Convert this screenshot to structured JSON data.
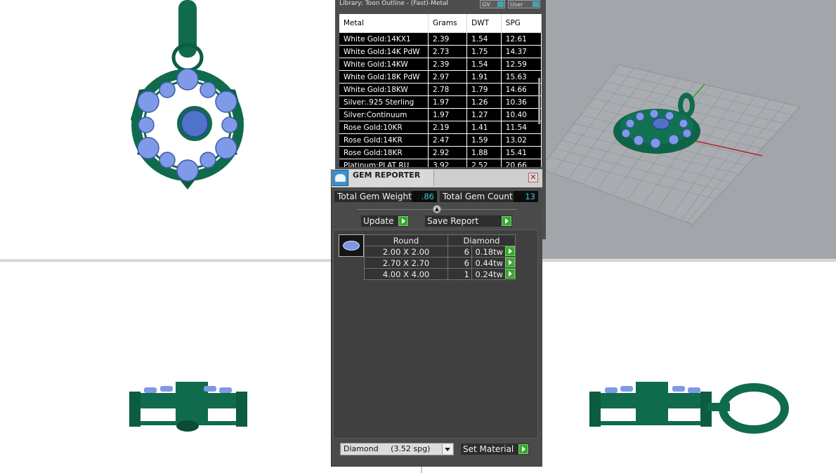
{
  "library": {
    "title": "Library: Toon Outline - (Fast)-Metal",
    "gv_label": "GV",
    "user_label": "User",
    "columns": [
      "Metal",
      "Grams",
      "DWT",
      "SPG"
    ],
    "rows": [
      [
        "White Gold:14KX1",
        "2.39",
        "1.54",
        "12.61"
      ],
      [
        "White Gold:14K PdW",
        "2.73",
        "1.75",
        "14.37"
      ],
      [
        "White Gold:14KW",
        "2.39",
        "1.54",
        "12.59"
      ],
      [
        "White Gold:18K PdW",
        "2.97",
        "1.91",
        "15.63"
      ],
      [
        "White Gold:18KW",
        "2.78",
        "1.79",
        "14.66"
      ],
      [
        "Silver:.925 Sterling",
        "1.97",
        "1.26",
        "10.36"
      ],
      [
        "Silver:Continuum",
        "1.97",
        "1.27",
        "10.40"
      ],
      [
        "Rose Gold:10KR",
        "2.19",
        "1.41",
        "11.54"
      ],
      [
        "Rose Gold:14KR",
        "2.47",
        "1.59",
        "13.02"
      ],
      [
        "Rose Gold:18KR",
        "2.92",
        "1.88",
        "15.41"
      ],
      [
        "Platinum:PLAT RU",
        "3.92",
        "2.52",
        "20.66"
      ]
    ]
  },
  "gem_reporter": {
    "title": "GEM REPORTER",
    "close_icon": "close-icon",
    "total_weight_label": "Total Gem Weight",
    "total_weight_value": ".86",
    "total_count_label": "Total Gem Count",
    "total_count_value": "13",
    "update_label": "Update",
    "save_report_label": "Save Report",
    "shape_header": "Round",
    "material_header": "Diamond",
    "gems": [
      {
        "size": "2.00 X 2.00",
        "count": "6",
        "weight": "0.18tw"
      },
      {
        "size": "2.70 X 2.70",
        "count": "6",
        "weight": "0.44tw"
      },
      {
        "size": "4.00 X 4.00",
        "count": "1",
        "weight": "0.24tw"
      }
    ],
    "material_select": "Diamond     (3.52 spg)",
    "set_material_label": "Set Material"
  },
  "colors": {
    "metal": "#0f6b4b",
    "gem": "#6f8fd8",
    "value_text": "#41c5e2",
    "go_button": "#37a82f"
  }
}
